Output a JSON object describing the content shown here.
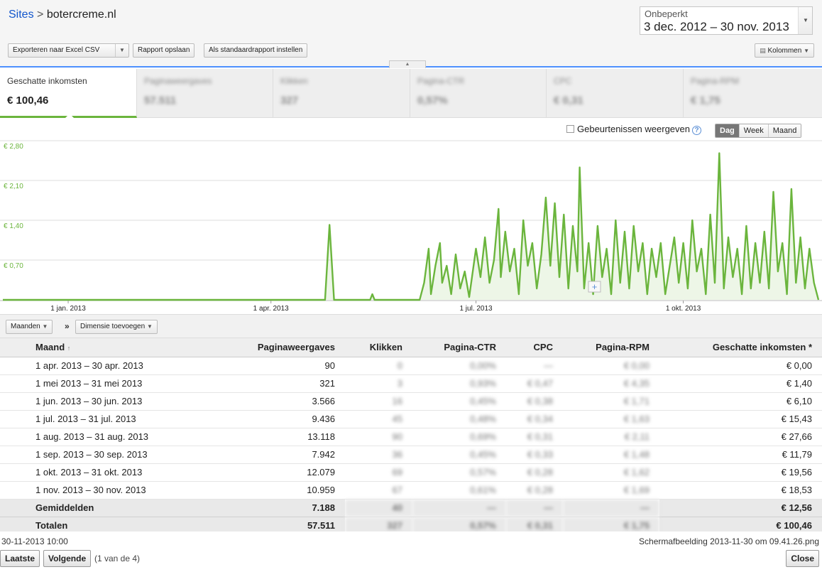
{
  "breadcrumb": {
    "root": "Sites",
    "separator": ">",
    "site": "botercreme.nl"
  },
  "date_range": {
    "label": "Onbeperkt",
    "value": "3 dec. 2012 – 30 nov. 2013"
  },
  "toolbar": {
    "export": "Exporteren naar Excel CSV",
    "save_report": "Rapport opslaan",
    "set_default": "Als standaardrapport instellen",
    "columns": "Kolommen"
  },
  "metrics": [
    {
      "name": "Geschatte inkomsten",
      "value": "€ 100,46"
    },
    {
      "name": "Paginaweergaves",
      "value": "57.511"
    },
    {
      "name": "Klikken",
      "value": "327"
    },
    {
      "name": "Pagina-CTR",
      "value": "0,57%"
    },
    {
      "name": "CPC",
      "value": "€ 0,31"
    },
    {
      "name": "Pagina-RPM",
      "value": "€ 1,75"
    }
  ],
  "chart_controls": {
    "events_label": "Gebeurtenissen weergeven",
    "periods": [
      "Dag",
      "Week",
      "Maand"
    ],
    "selected_period": "Dag"
  },
  "chart_data": {
    "type": "area",
    "y_ticks": [
      "€ 2,80",
      "€ 2,10",
      "€ 1,40",
      "€ 0,70"
    ],
    "ylim": [
      0,
      2.8
    ],
    "x_ticks": [
      "1 jan. 2013",
      "1 apr. 2013",
      "1 jul. 2013",
      "1 okt. 2013"
    ],
    "x_range": [
      "2012-12-03",
      "2013-11-30"
    ],
    "color": "#6bb53d",
    "series": [
      {
        "points": [
          [
            "2012-12-03",
            0
          ],
          [
            "2013-04-25",
            0
          ],
          [
            "2013-04-27",
            1.32
          ],
          [
            "2013-04-29",
            0
          ],
          [
            "2013-05-15",
            0
          ],
          [
            "2013-05-16",
            0.1
          ],
          [
            "2013-05-17",
            0
          ],
          [
            "2013-06-06",
            0
          ],
          [
            "2013-06-08",
            0.3
          ],
          [
            "2013-06-10",
            0.9
          ],
          [
            "2013-06-11",
            0.1
          ],
          [
            "2013-06-13",
            0.6
          ],
          [
            "2013-06-15",
            1.0
          ],
          [
            "2013-06-16",
            0.3
          ],
          [
            "2013-06-18",
            0.6
          ],
          [
            "2013-06-20",
            0.1
          ],
          [
            "2013-06-22",
            0.8
          ],
          [
            "2013-06-24",
            0.2
          ],
          [
            "2013-06-26",
            0.5
          ],
          [
            "2013-06-28",
            0.05
          ],
          [
            "2013-07-01",
            0.9
          ],
          [
            "2013-07-03",
            0.4
          ],
          [
            "2013-07-05",
            1.1
          ],
          [
            "2013-07-07",
            0.3
          ],
          [
            "2013-07-09",
            0.7
          ],
          [
            "2013-07-11",
            1.6
          ],
          [
            "2013-07-12",
            0.4
          ],
          [
            "2013-07-14",
            1.2
          ],
          [
            "2013-07-16",
            0.5
          ],
          [
            "2013-07-18",
            0.9
          ],
          [
            "2013-07-20",
            0.1
          ],
          [
            "2013-07-22",
            1.4
          ],
          [
            "2013-07-24",
            0.6
          ],
          [
            "2013-07-26",
            1.0
          ],
          [
            "2013-07-28",
            0.2
          ],
          [
            "2013-07-30",
            0.8
          ],
          [
            "2013-08-01",
            1.8
          ],
          [
            "2013-08-03",
            0.6
          ],
          [
            "2013-08-05",
            1.7
          ],
          [
            "2013-08-07",
            0.4
          ],
          [
            "2013-08-09",
            1.5
          ],
          [
            "2013-08-11",
            0.2
          ],
          [
            "2013-08-13",
            1.3
          ],
          [
            "2013-08-15",
            0.5
          ],
          [
            "2013-08-16",
            2.33
          ],
          [
            "2013-08-18",
            0.2
          ],
          [
            "2013-08-20",
            1.0
          ],
          [
            "2013-08-22",
            0.1
          ],
          [
            "2013-08-24",
            1.3
          ],
          [
            "2013-08-26",
            0.4
          ],
          [
            "2013-08-28",
            0.9
          ],
          [
            "2013-08-30",
            0.1
          ],
          [
            "2013-09-01",
            1.4
          ],
          [
            "2013-09-03",
            0.3
          ],
          [
            "2013-09-05",
            1.2
          ],
          [
            "2013-09-07",
            0.2
          ],
          [
            "2013-09-09",
            1.3
          ],
          [
            "2013-09-11",
            0.5
          ],
          [
            "2013-09-13",
            1.0
          ],
          [
            "2013-09-15",
            0.1
          ],
          [
            "2013-09-17",
            0.9
          ],
          [
            "2013-09-19",
            0.4
          ],
          [
            "2013-09-21",
            1.0
          ],
          [
            "2013-09-23",
            0.1
          ],
          [
            "2013-09-25",
            0.6
          ],
          [
            "2013-09-27",
            1.1
          ],
          [
            "2013-09-29",
            0.3
          ],
          [
            "2013-10-01",
            1.0
          ],
          [
            "2013-10-03",
            0.2
          ],
          [
            "2013-10-05",
            1.4
          ],
          [
            "2013-10-07",
            0.5
          ],
          [
            "2013-10-09",
            0.9
          ],
          [
            "2013-10-11",
            0.1
          ],
          [
            "2013-10-13",
            1.5
          ],
          [
            "2013-10-15",
            0.3
          ],
          [
            "2013-10-17",
            2.58
          ],
          [
            "2013-10-19",
            0.2
          ],
          [
            "2013-10-21",
            1.1
          ],
          [
            "2013-10-23",
            0.4
          ],
          [
            "2013-10-25",
            0.9
          ],
          [
            "2013-10-27",
            0.1
          ],
          [
            "2013-10-29",
            1.3
          ],
          [
            "2013-10-31",
            0.2
          ],
          [
            "2013-11-02",
            1.0
          ],
          [
            "2013-11-04",
            0.3
          ],
          [
            "2013-11-06",
            1.2
          ],
          [
            "2013-11-08",
            0.2
          ],
          [
            "2013-11-10",
            1.9
          ],
          [
            "2013-11-12",
            0.5
          ],
          [
            "2013-11-14",
            1.0
          ],
          [
            "2013-11-16",
            0.1
          ],
          [
            "2013-11-18",
            1.95
          ],
          [
            "2013-11-20",
            0.3
          ],
          [
            "2013-11-22",
            1.1
          ],
          [
            "2013-11-24",
            0.2
          ],
          [
            "2013-11-26",
            0.9
          ],
          [
            "2013-11-28",
            0.3
          ],
          [
            "2013-11-30",
            0.0
          ]
        ]
      }
    ]
  },
  "dimensions": {
    "primary": "Maanden",
    "separator": "»",
    "add": "Dimensie toevoegen"
  },
  "table": {
    "headers": [
      "Maand",
      "Paginaweergaves",
      "Klikken",
      "Pagina-CTR",
      "CPC",
      "Pagina-RPM",
      "Geschatte inkomsten *"
    ],
    "sort_indicator": "↑",
    "rows": [
      [
        "1 apr. 2013 – 30 apr. 2013",
        "90",
        "0",
        "0,00%",
        "—",
        "€ 0,00",
        "€ 0,00"
      ],
      [
        "1 mei 2013 – 31 mei 2013",
        "321",
        "3",
        "0,93%",
        "€ 0,47",
        "€ 4,35",
        "€ 1,40"
      ],
      [
        "1 jun. 2013 – 30 jun. 2013",
        "3.566",
        "16",
        "0,45%",
        "€ 0,38",
        "€ 1,71",
        "€ 6,10"
      ],
      [
        "1 jul. 2013 – 31 jul. 2013",
        "9.436",
        "45",
        "0,48%",
        "€ 0,34",
        "€ 1,63",
        "€ 15,43"
      ],
      [
        "1 aug. 2013 – 31 aug. 2013",
        "13.118",
        "90",
        "0,69%",
        "€ 0,31",
        "€ 2,11",
        "€ 27,66"
      ],
      [
        "1 sep. 2013 – 30 sep. 2013",
        "7.942",
        "36",
        "0,45%",
        "€ 0,33",
        "€ 1,48",
        "€ 11,79"
      ],
      [
        "1 okt. 2013 – 31 okt. 2013",
        "12.079",
        "69",
        "0,57%",
        "€ 0,28",
        "€ 1,62",
        "€ 19,56"
      ],
      [
        "1 nov. 2013 – 30 nov. 2013",
        "10.959",
        "67",
        "0,61%",
        "€ 0,28",
        "€ 1,69",
        "€ 18,53"
      ]
    ],
    "averages": [
      "Gemiddelden",
      "7.188",
      "40",
      "—",
      "—",
      "—",
      "€ 12,56"
    ],
    "totals": [
      "Totalen",
      "57.511",
      "327",
      "0,57%",
      "€ 0,31",
      "€ 1,75",
      "€ 100,46"
    ]
  },
  "footer": {
    "timestamp": "30-11-2013 10:00",
    "filename": "Schermafbeelding 2013-11-30 om 09.41.26.png",
    "last": "Laatste",
    "next": "Volgende",
    "page_info": "(1 van de 4)",
    "close": "Close"
  }
}
